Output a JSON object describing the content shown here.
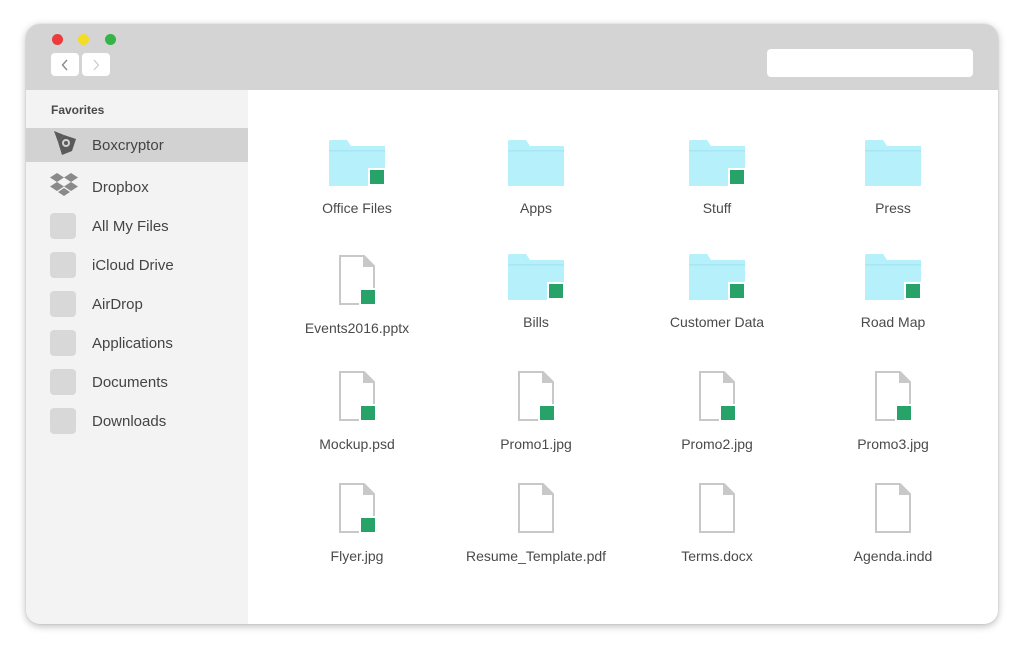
{
  "window": {
    "traffic_lights": [
      "close",
      "minimize",
      "zoom"
    ],
    "nav": {
      "back_icon": "chevron-left-icon",
      "forward_icon": "chevron-right-icon"
    },
    "search": {
      "value": "",
      "placeholder": ""
    }
  },
  "sidebar": {
    "heading": "Favorites",
    "items": [
      {
        "label": "Boxcryptor",
        "icon": "boxcryptor-icon",
        "selected": true
      },
      {
        "label": "Dropbox",
        "icon": "dropbox-icon",
        "selected": false
      },
      {
        "label": "All My Files",
        "icon": "placeholder-icon",
        "selected": false
      },
      {
        "label": "iCloud Drive",
        "icon": "placeholder-icon",
        "selected": false
      },
      {
        "label": "AirDrop",
        "icon": "placeholder-icon",
        "selected": false
      },
      {
        "label": "Applications",
        "icon": "placeholder-icon",
        "selected": false
      },
      {
        "label": "Documents",
        "icon": "placeholder-icon",
        "selected": false
      },
      {
        "label": "Downloads",
        "icon": "placeholder-icon",
        "selected": false
      }
    ]
  },
  "content": {
    "items": [
      {
        "label": "Office Files",
        "type": "folder",
        "encrypted": true
      },
      {
        "label": "Apps",
        "type": "folder",
        "encrypted": false
      },
      {
        "label": "Stuff",
        "type": "folder",
        "encrypted": true
      },
      {
        "label": "Press",
        "type": "folder",
        "encrypted": false
      },
      {
        "label": "Events2016.pptx",
        "type": "file",
        "encrypted": true
      },
      {
        "label": "Bills",
        "type": "folder",
        "encrypted": true
      },
      {
        "label": "Customer Data",
        "type": "folder",
        "encrypted": true
      },
      {
        "label": "Road Map",
        "type": "folder",
        "encrypted": true
      },
      {
        "label": "Mockup.psd",
        "type": "file",
        "encrypted": true
      },
      {
        "label": "Promo1.jpg",
        "type": "file",
        "encrypted": true
      },
      {
        "label": "Promo2.jpg",
        "type": "file",
        "encrypted": true
      },
      {
        "label": "Promo3.jpg",
        "type": "file",
        "encrypted": true
      },
      {
        "label": "Flyer.jpg",
        "type": "file",
        "encrypted": true
      },
      {
        "label": "Resume_Template.pdf",
        "type": "file",
        "encrypted": false
      },
      {
        "label": "Terms.docx",
        "type": "file",
        "encrypted": false
      },
      {
        "label": "Agenda.indd",
        "type": "file",
        "encrypted": false
      }
    ]
  },
  "colors": {
    "folder": "#b5f0fb",
    "encrypted_badge": "#27a36a",
    "file_outline": "#c8c8c8",
    "sidebar_selected": "#d2d2d2",
    "titlebar": "#d4d4d4"
  }
}
